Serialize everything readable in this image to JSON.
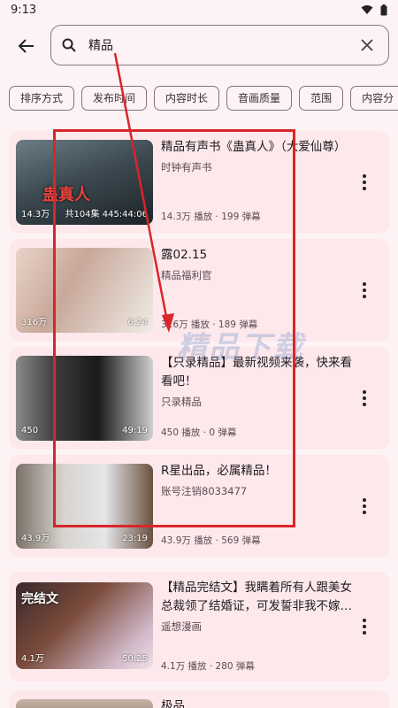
{
  "status_bar": {
    "time": "9:13"
  },
  "search": {
    "value": "精品",
    "placeholder": ""
  },
  "filters": [
    "排序方式",
    "发布时间",
    "内容时长",
    "音画质量",
    "范围",
    "内容分"
  ],
  "videos": [
    {
      "title": "精品有声书《蛊真人》（大爱仙尊）",
      "author": "时钟有声书",
      "views": "14.3万",
      "duration": "共104集 445:44:06",
      "stats": "14.3万 播放 · 199 弹幕",
      "thumb_text": "蛊真人"
    },
    {
      "title": "露02.15",
      "author": "精品福利官",
      "views": "316万",
      "duration": "6:24",
      "stats": "316万 播放 · 189 弹幕",
      "thumb_text": ""
    },
    {
      "title": "【只录精品】最新视频来袭，快来看看吧！",
      "author": "只录精品",
      "views": "450",
      "duration": "49:19",
      "stats": "450 播放 · 0 弹幕",
      "thumb_text": ""
    },
    {
      "title": "R星出品，必属精品！",
      "author": "账号注销8033477",
      "views": "43.9万",
      "duration": "23:19",
      "stats": "43.9万 播放 · 569 弹幕",
      "thumb_text": ""
    },
    {
      "title": "【精品完结文】我瞒着所有人跟美女总裁领了结婚证，可发誓非我不嫁的三个未婚妻…",
      "author": "遥想漫画",
      "views": "4.1万",
      "duration": "50:25",
      "stats": "4.1万 播放 · 280 弹幕",
      "thumb_text": "完结文"
    },
    {
      "title": "极品",
      "author": "",
      "views": "",
      "duration": "",
      "stats": "",
      "thumb_text": ""
    }
  ],
  "watermark": "精品下载",
  "colors": {
    "background": "#fdf2f4",
    "card": "#fde8ec",
    "annotation": "#d8262a"
  }
}
